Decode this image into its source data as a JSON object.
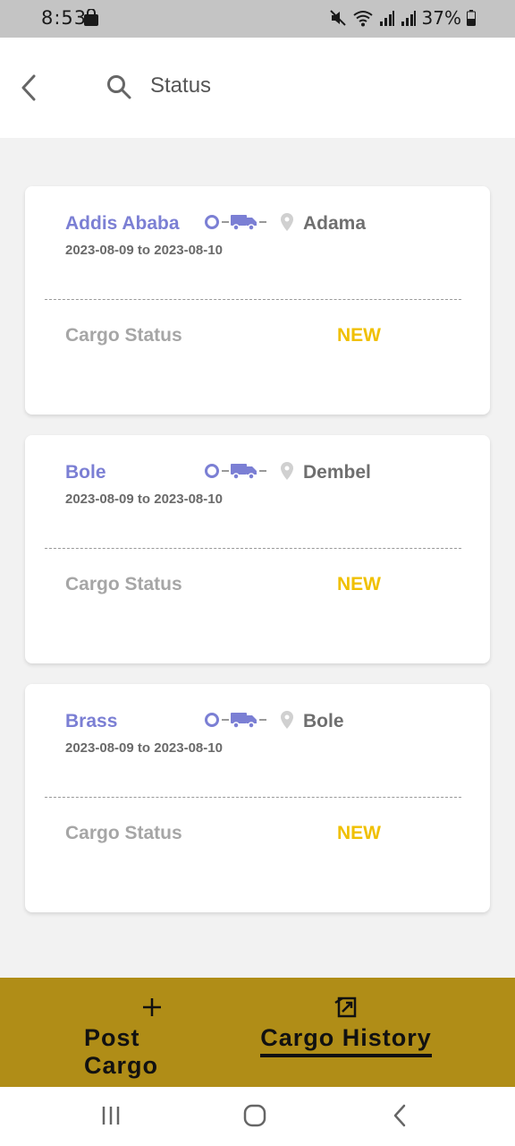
{
  "status_bar": {
    "time": "8:53",
    "battery": "37%"
  },
  "app_bar": {
    "title": "Status"
  },
  "cards": [
    {
      "origin": "Addis Ababa",
      "destination": "Adama",
      "dates": "2023-08-09 to 2023-08-10",
      "status_label": "Cargo Status",
      "status_value": "NEW"
    },
    {
      "origin": "Bole",
      "destination": "Dembel",
      "dates": "2023-08-09 to 2023-08-10",
      "status_label": "Cargo Status",
      "status_value": "NEW"
    },
    {
      "origin": "Brass",
      "destination": "Bole",
      "dates": "2023-08-09 to 2023-08-10",
      "status_label": "Cargo Status",
      "status_value": "NEW"
    }
  ],
  "bottom_nav": {
    "post_cargo": "Post Cargo",
    "cargo_history": "Cargo History"
  },
  "colors": {
    "accent": "#7b7fd4",
    "status_new": "#f0c000",
    "bottom_nav_bg": "#b08d17"
  }
}
